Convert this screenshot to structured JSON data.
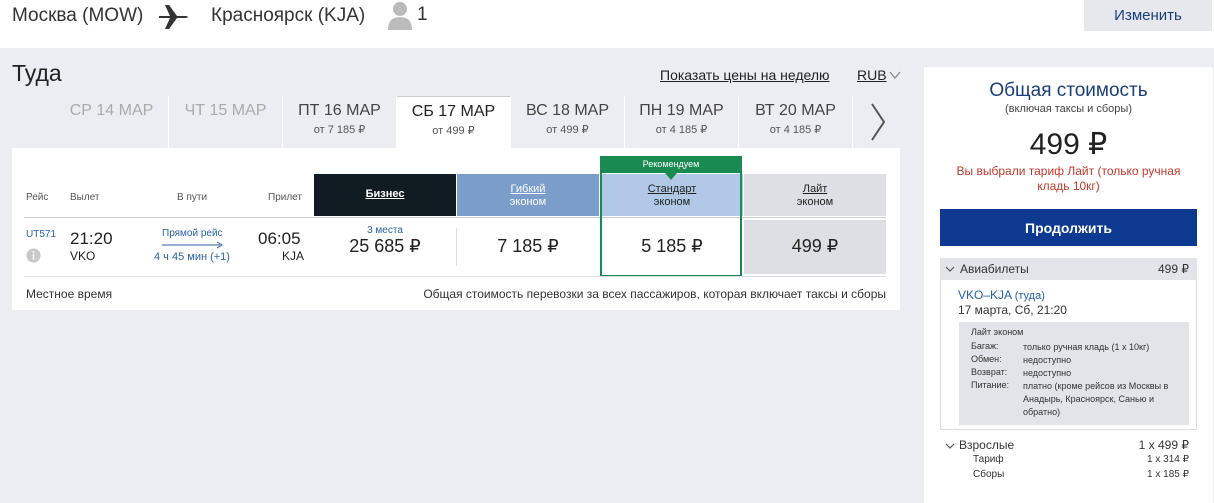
{
  "header": {
    "from": "Москва (MOW)",
    "to": "Красноярск (KJA)",
    "passengers": "1",
    "change_label": "Изменить"
  },
  "direction": {
    "title": "Туда",
    "week_link": "Показать цены на неделю",
    "currency": "RUB"
  },
  "dates": [
    {
      "day": "СР 14 МАР",
      "price": "",
      "state": "disabled"
    },
    {
      "day": "ЧТ 15 МАР",
      "price": "",
      "state": "disabled"
    },
    {
      "day": "ПТ 16 МАР",
      "price": "от 7 185 ₽",
      "state": "normal"
    },
    {
      "day": "СБ 17 МАР",
      "price": "от 499 ₽",
      "state": "active"
    },
    {
      "day": "ВС 18 МАР",
      "price": "от 499 ₽",
      "state": "normal"
    },
    {
      "day": "ПН 19 МАР",
      "price": "от 4 185 ₽",
      "state": "normal"
    },
    {
      "day": "ВТ 20 МАР",
      "price": "от 4 185 ₽",
      "state": "normal"
    }
  ],
  "table": {
    "headers": {
      "flight": "Рейс",
      "departure": "Вылет",
      "duration": "В пути",
      "arrival": "Прилет"
    },
    "recommend_label": "Рекомендуем",
    "fares": {
      "business": "Бизнес",
      "flex_line1": "Гибкий",
      "flex_line2": "эконом",
      "standard_line1": "Стандарт",
      "standard_line2": "эконом",
      "lite_line1": "Лайт",
      "lite_line2": "эконом"
    },
    "row": {
      "flight_no": "UT571",
      "dep_time": "21:20",
      "dep_airport": "VKO",
      "direct": "Прямой рейс",
      "duration": "4 ч 45 мин (+1)",
      "arr_time": "06:05",
      "arr_airport": "KJA",
      "business_seats": "3 места",
      "business_price": "25 685 ₽",
      "flex_price": "7 185 ₽",
      "standard_price": "5 185 ₽",
      "lite_price": "499 ₽"
    },
    "local_time": "Местное время",
    "total_note": "Общая стоимость перевозки за всех пассажиров, которая включает таксы и сборы"
  },
  "summary": {
    "title": "Общая стоимость",
    "subtitle": "(включая таксы и сборы)",
    "price": "499 ₽",
    "note": "Вы выбрали тариф Лайт (только ручная кладь 10кг)",
    "continue_label": "Продолжить",
    "tickets_label": "Авиабилеты",
    "tickets_price": "499 ₽",
    "segment_route": "VKO–KJA",
    "segment_dir": "(туда)",
    "segment_date": "17 марта, Сб, 21:20",
    "fare_name": "Лайт эконом",
    "conditions": [
      {
        "k": "Багаж:",
        "v": "только ручная кладь (1 x 10кг)"
      },
      {
        "k": "Обмен:",
        "v": "недоступно"
      },
      {
        "k": "Возврат:",
        "v": "недоступно"
      },
      {
        "k": "Питание:",
        "v": "платно (кроме рейсов из Москвы в Анадырь, Красноярск, Санью и обратно)"
      }
    ],
    "adults_label": "Взрослые",
    "adults_value": "1 x 499 ₽",
    "tariff_label": "Тариф",
    "tariff_value": "1 x 314 ₽",
    "fees_label": "Сборы",
    "fees_value": "1 x 185 ₽"
  },
  "colors": {
    "brand_blue": "#0d3991",
    "recommend_green": "#1a8a53",
    "note_red": "#c0392b",
    "business_dark": "#111b22"
  }
}
